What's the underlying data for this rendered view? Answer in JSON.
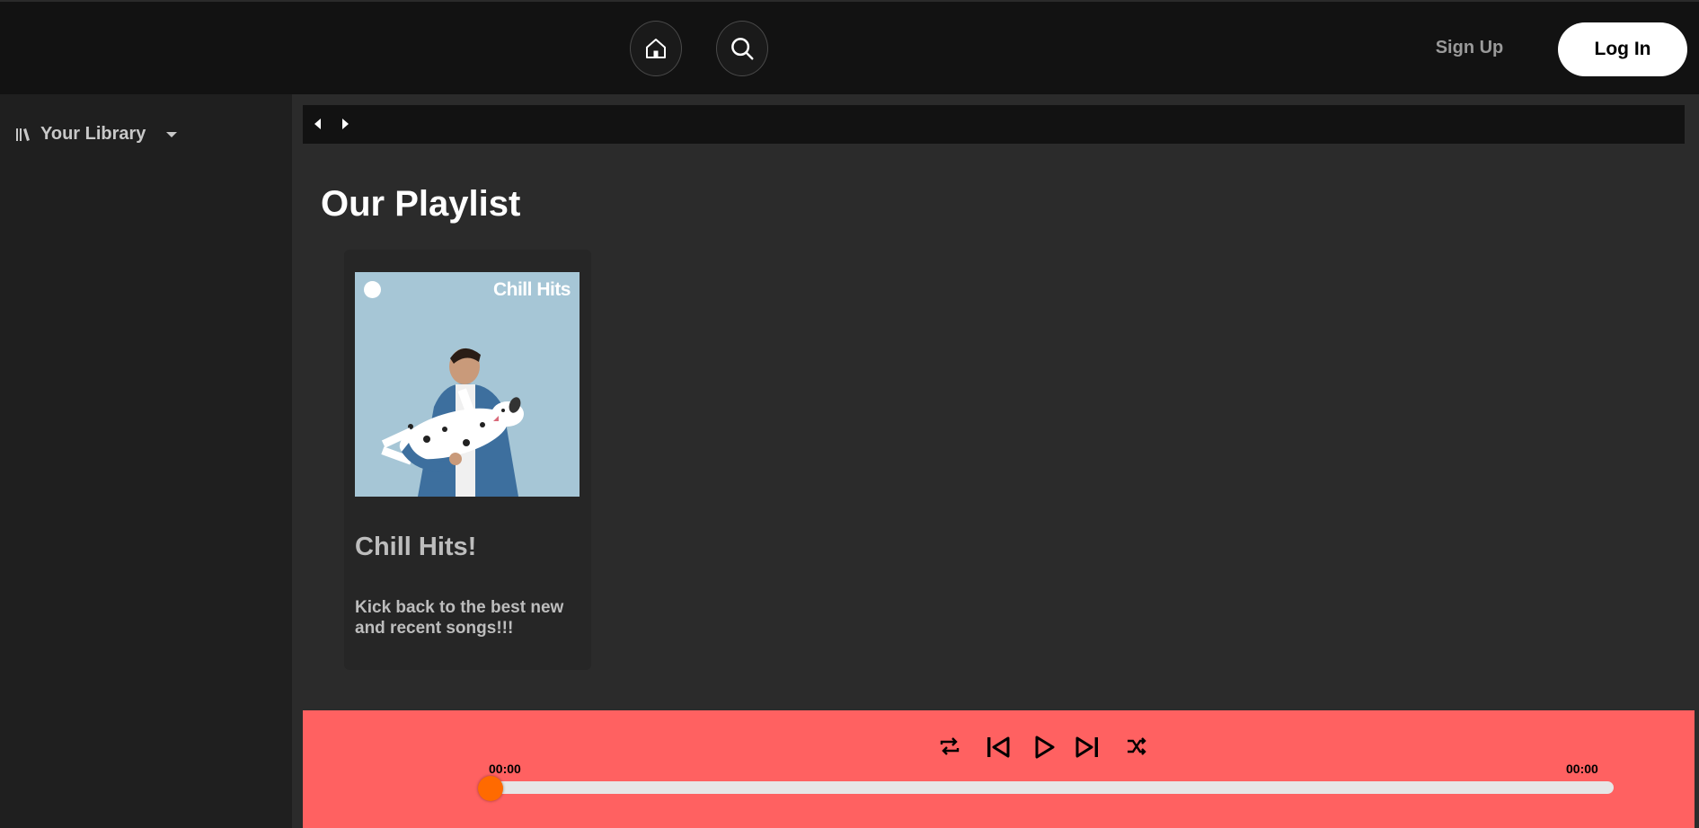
{
  "header": {
    "signup_label": "Sign Up",
    "login_label": "Log In",
    "home_icon": "home-icon",
    "search_icon": "search-icon"
  },
  "sidebar": {
    "library_label": "Your Library",
    "library_icon": "library-icon",
    "chevron_icon": "caret-down-icon"
  },
  "main": {
    "heading": "Our Playlist",
    "playlists": [
      {
        "cover_text": "Chill Hits",
        "title": "Chill Hits!",
        "description": "Kick back to the best new and recent songs!!!"
      }
    ]
  },
  "player": {
    "current_time": "00:00",
    "total_time": "00:00",
    "progress": 0,
    "controls": [
      "repeat-icon",
      "previous-icon",
      "play-icon",
      "next-icon",
      "shuffle-icon"
    ]
  },
  "colors": {
    "topbar": "#121212",
    "sidebar": "#1f1f1f",
    "main": "#2b2b2b",
    "player": "#ff6161",
    "thumb": "#ff6a00",
    "login_bg": "#ffffff"
  }
}
